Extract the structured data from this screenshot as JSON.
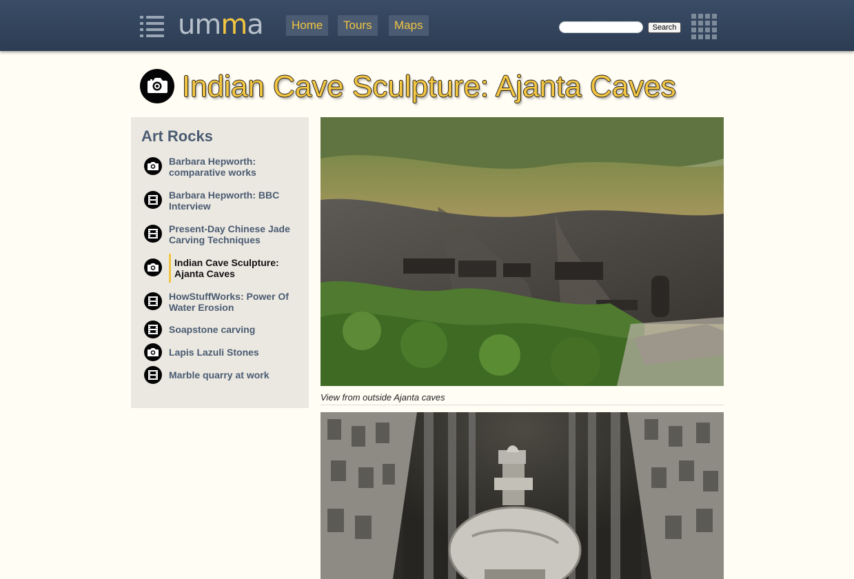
{
  "header": {
    "logo_prefix": "um",
    "logo_accent": "m",
    "logo_suffix": "a",
    "nav": [
      {
        "label": "Home"
      },
      {
        "label": "Tours"
      },
      {
        "label": "Maps"
      }
    ],
    "search": {
      "value": "",
      "button_label": "Search"
    }
  },
  "page": {
    "title": "Indian Cave Sculpture: Ajanta Caves",
    "title_icon": "camera-icon"
  },
  "sidebar": {
    "heading": "Art Rocks",
    "items": [
      {
        "label": "Barbara Hepworth: comparative works",
        "icon": "camera-icon"
      },
      {
        "label": "Barbara Hepworth: BBC Interview",
        "icon": "film-icon"
      },
      {
        "label": "Present-Day Chinese Jade Carving Techniques",
        "icon": "film-icon"
      },
      {
        "label": "Indian Cave Sculpture: Ajanta Caves",
        "icon": "camera-icon",
        "active": true
      },
      {
        "label": "HowStuffWorks: Power Of Water Erosion",
        "icon": "film-icon"
      },
      {
        "label": "Soapstone carving",
        "icon": "film-icon"
      },
      {
        "label": "Lapis Lazuli Stones",
        "icon": "camera-icon"
      },
      {
        "label": "Marble quarry at work",
        "icon": "film-icon"
      }
    ]
  },
  "main": {
    "photos": [
      {
        "caption": "View from outside Ajanta caves"
      },
      {
        "caption": ""
      }
    ]
  },
  "colors": {
    "header": "#2f405a",
    "accent": "#f2c542",
    "link": "#4a5b72",
    "page_bg": "#fffdf4",
    "sidebar_bg": "#ebe8e1"
  }
}
